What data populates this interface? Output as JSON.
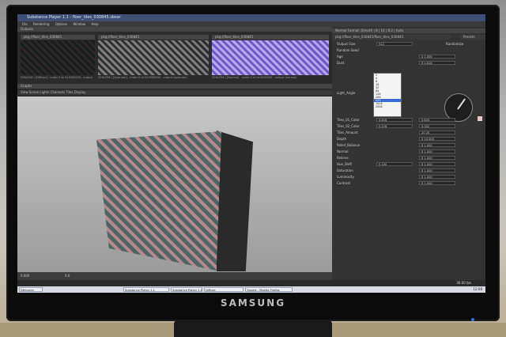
{
  "window": {
    "title": "Substance Player 1.1 - floor_tiles_030845.sbsar",
    "menu": [
      "File",
      "Rendering",
      "Options",
      "Window",
      "Help"
    ]
  },
  "outputs": {
    "header_left": "Outputs",
    "thumbs": [
      {
        "header": "pkg://floor_tiles_030845",
        "caption": "256x256 / [Diffuse] - Index 0 at 0x3500000 - output"
      },
      {
        "header": "pkg://floor_tiles_030845",
        "caption": "256x256 / [Specular] - Index 0 at 0x3500000 - output (specular)"
      },
      {
        "header": "pkg://floor_tiles_030845",
        "caption": "256x256 / [Normal] - Index 0 at 0x3500000 - output (normal)"
      }
    ]
  },
  "viewport": {
    "header": "Graphs",
    "toolbar": "View  Scene  Lights  Channels  Tiles  Display",
    "zoom": "0.000",
    "frame": "0.0"
  },
  "panel": {
    "format": "Normal Format: DirectX | 8 | 16 | 8:2 | Auto",
    "package": "pkg://floor_tiles_030845/floor_tiles_030845",
    "presets": "Presets",
    "output_size_label": "Output Size",
    "output_size_value": "512",
    "randomize_label": "Randomize",
    "dropdown": [
      "2",
      "4",
      "8",
      "16",
      "32",
      "64",
      "128",
      "256",
      "512",
      "1024",
      "2048"
    ],
    "dropdown_selected": "512",
    "params": [
      {
        "label": "Random Seed",
        "v1": "",
        "v2": ""
      },
      {
        "label": "Age",
        "v1": "",
        "v2": "0 1.000"
      },
      {
        "label": "Dust",
        "v1": "",
        "v2": "0 0.816"
      },
      {
        "label": "Light_Angle",
        "v1": "",
        "v2": ""
      },
      {
        "label": "Tiles_01_Color",
        "v1": "0.816",
        "v2": "0.604"
      },
      {
        "label": "Tiles_02_Color",
        "v1": "0.376",
        "v2": "0.302"
      },
      {
        "label": "Tiles_Amount",
        "v1": "",
        "v2": "20 20"
      },
      {
        "label": "Depth",
        "v1": "",
        "v2": "0 10.000"
      },
      {
        "label": "Relief_Balance",
        "v1": "",
        "v2": "0 1.000"
      },
      {
        "label": "Normal",
        "v1": "",
        "v2": "0 1.000"
      },
      {
        "label": "Relieve",
        "v1": "",
        "v2": "0 1.000"
      },
      {
        "label": "Hue_Shift",
        "v1": "0 100",
        "v2": "0 1.000"
      },
      {
        "label": "Saturation",
        "v1": "",
        "v2": "0 1.000"
      },
      {
        "label": "Luminosity",
        "v1": "",
        "v2": "0 1.000"
      },
      {
        "label": "Contrast",
        "v1": "",
        "v2": "0 1.000"
      }
    ]
  },
  "taskbar": {
    "start": "Démarrer",
    "items": [
      "Substance Player 1.1",
      "Substance Player 1.1",
      "Diffuse",
      "Google - Mozilla Firefox"
    ],
    "clock": "12:08"
  },
  "status": {
    "fps": "30.00 fps"
  },
  "monitor": {
    "brand": "SAMSUNG"
  }
}
